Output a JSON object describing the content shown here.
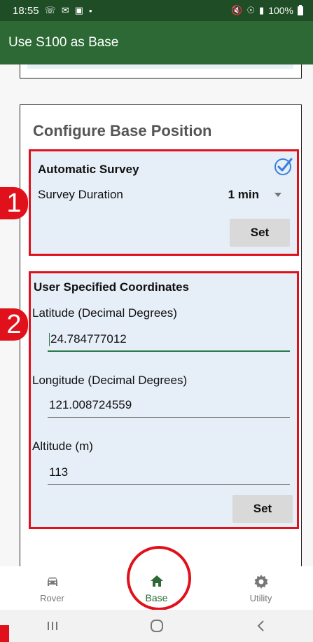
{
  "status_bar": {
    "time": "18:55",
    "battery": "100%",
    "icons": [
      "whatsapp-icon",
      "mail-icon",
      "image-icon",
      "dot-icon",
      "mute-icon",
      "wifi-icon",
      "signal-icon",
      "battery-icon"
    ]
  },
  "app_bar": {
    "title": "Use S100 as Base"
  },
  "config": {
    "title": "Configure Base Position",
    "auto": {
      "title": "Automatic Survey",
      "checked": true,
      "duration_label": "Survey Duration",
      "duration_value": "1 min",
      "set_label": "Set"
    },
    "user": {
      "title": "User Specified Coordinates",
      "lat_label": "Latitude (Decimal Degrees)",
      "lat_value": "24.784777012",
      "lon_label": "Longitude (Decimal Degrees)",
      "lon_value": "121.008724559",
      "alt_label": "Altitude (m)",
      "alt_value": "113",
      "set_label": "Set"
    }
  },
  "annotations": {
    "badge_1": "1",
    "badge_2": "2"
  },
  "bottom_nav": {
    "items": [
      {
        "label": "Rover",
        "icon": "car-icon",
        "active": false
      },
      {
        "label": "Base",
        "icon": "home-icon",
        "active": true
      },
      {
        "label": "Utility",
        "icon": "gear-icon",
        "active": false
      }
    ]
  },
  "colors": {
    "status_bar": "#1f4d26",
    "app_bar": "#2c6935",
    "accent_red": "#e0111b",
    "panel_bg": "#e6eef7",
    "check_blue": "#3b7ddd"
  }
}
